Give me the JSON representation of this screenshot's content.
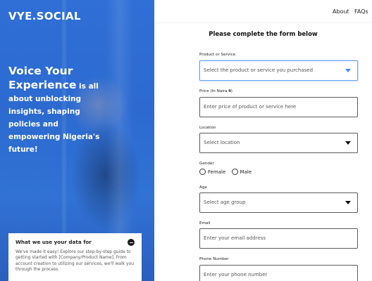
{
  "brand": {
    "logo": "VYE.SOCIAL"
  },
  "hero": {
    "line1": "Voice Your",
    "line2_big": "Experience",
    "line2_rest": " is all",
    "line3": "about unblocking",
    "line4": "insights, shaping",
    "line5": "policies and",
    "line6": "empowering Nigeria's",
    "line7": "future!"
  },
  "data_card": {
    "title": "What we use your data for",
    "body": "We've made it easy! Explore our step-by-step guide to getting started with [Company/Product Name]. From account creation to utilizing our services, we'll walk you through the process."
  },
  "nav": {
    "about": "About",
    "faqs": "FAQs"
  },
  "form": {
    "title": "Please complete the form below",
    "product": {
      "label": "Product or Service",
      "value": "Select the product or service you purchased"
    },
    "price": {
      "label": "Price (In Naira ₦)",
      "placeholder": "Enter price of product or service here"
    },
    "location": {
      "label": "Location",
      "value": "Select location"
    },
    "gender": {
      "label": "Gender",
      "options": [
        "Female",
        "Male"
      ]
    },
    "age": {
      "label": "Age",
      "value": "Select age group"
    },
    "email": {
      "label": "Email",
      "placeholder": "Enter your email address"
    },
    "phone": {
      "label": "Phone Number",
      "placeholder": "Enter your phone number"
    }
  },
  "colors": {
    "left_panel": "#2f6fd6",
    "focus_border": "#6fa3ff",
    "caret_active": "#3c8bff"
  },
  "icons": {
    "collapse": "minus-circle-icon",
    "dropdown": "caret-down-icon"
  }
}
